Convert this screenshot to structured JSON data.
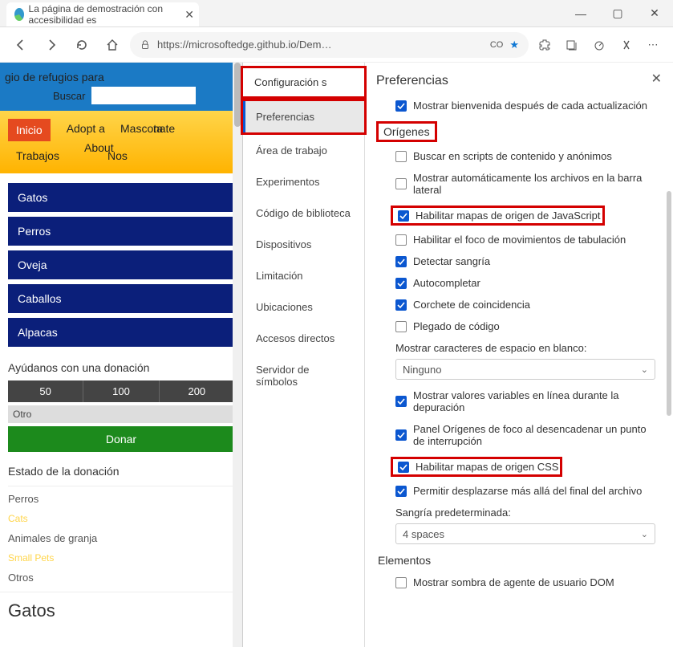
{
  "titlebar": {
    "tab_title": "La página de demostración con accesibilidad es"
  },
  "toolbar": {
    "url": "https://microsoftedge.github.io/Dem…",
    "translate_badge": "CO"
  },
  "page": {
    "header_title": "gio de refugios para",
    "search_label": "Buscar",
    "nav": {
      "inicio": "Inicio",
      "adopt": "Adopt a",
      "mascota": "Mascota",
      "donate": "nate",
      "trabajos": "Trabajos",
      "about": "About",
      "nos": "Nos"
    },
    "animals": [
      "Gatos",
      "Perros",
      "Oveja",
      "Caballos",
      "Alpacas"
    ],
    "donation": {
      "title": "Ayúdanos con una donación",
      "amounts": [
        "50",
        "100",
        "200"
      ],
      "otro": "Otro",
      "donar": "Donar"
    },
    "status": {
      "title": "Estado de la donación",
      "items": [
        "Perros",
        "Cats",
        "Animales de granja",
        "Small Pets",
        "Otros"
      ]
    },
    "gatos_heading": "Gatos"
  },
  "devtools": {
    "config_header": "Configuración s",
    "sidebar_items": [
      "Preferencias",
      "Área de trabajo",
      "Experimentos",
      "Código de biblioteca",
      "Dispositivos",
      "Limitación",
      "Ubicaciones",
      "Accesos directos",
      "Servidor de símbolos"
    ],
    "content": {
      "title": "Preferencias",
      "welcome": "Mostrar bienvenida después de cada actualización",
      "origins_h": "Orígenes",
      "c_search": "Buscar en scripts de contenido y anónimos",
      "c_auto": "Mostrar automáticamente los archivos en la barra lateral",
      "c_jsmaps": "Habilitar mapas de origen de JavaScript",
      "c_tabfocus": "Habilitar el foco de movimientos de tabulación",
      "c_indent": "Detectar sangría",
      "c_autocomplete": "Autocompletar",
      "c_bracket": "Corchete de coincidencia",
      "c_fold": "Plegado de código",
      "whitespace_label": "Mostrar caracteres de espacio en blanco:",
      "whitespace_value": "Ninguno",
      "c_inline": "Mostrar valores variables en línea durante la depuración",
      "c_focuspanel": "Panel Orígenes de foco al desencadenar un punto de interrupción",
      "c_cssmaps": "Habilitar mapas de origen CSS",
      "c_scroll": "Permitir desplazarse más allá del final del archivo",
      "indent_label": "Sangría predeterminada:",
      "indent_value": "4 spaces",
      "elements_h": "Elementos",
      "c_shadow": "Mostrar sombra de agente de usuario DOM"
    }
  }
}
